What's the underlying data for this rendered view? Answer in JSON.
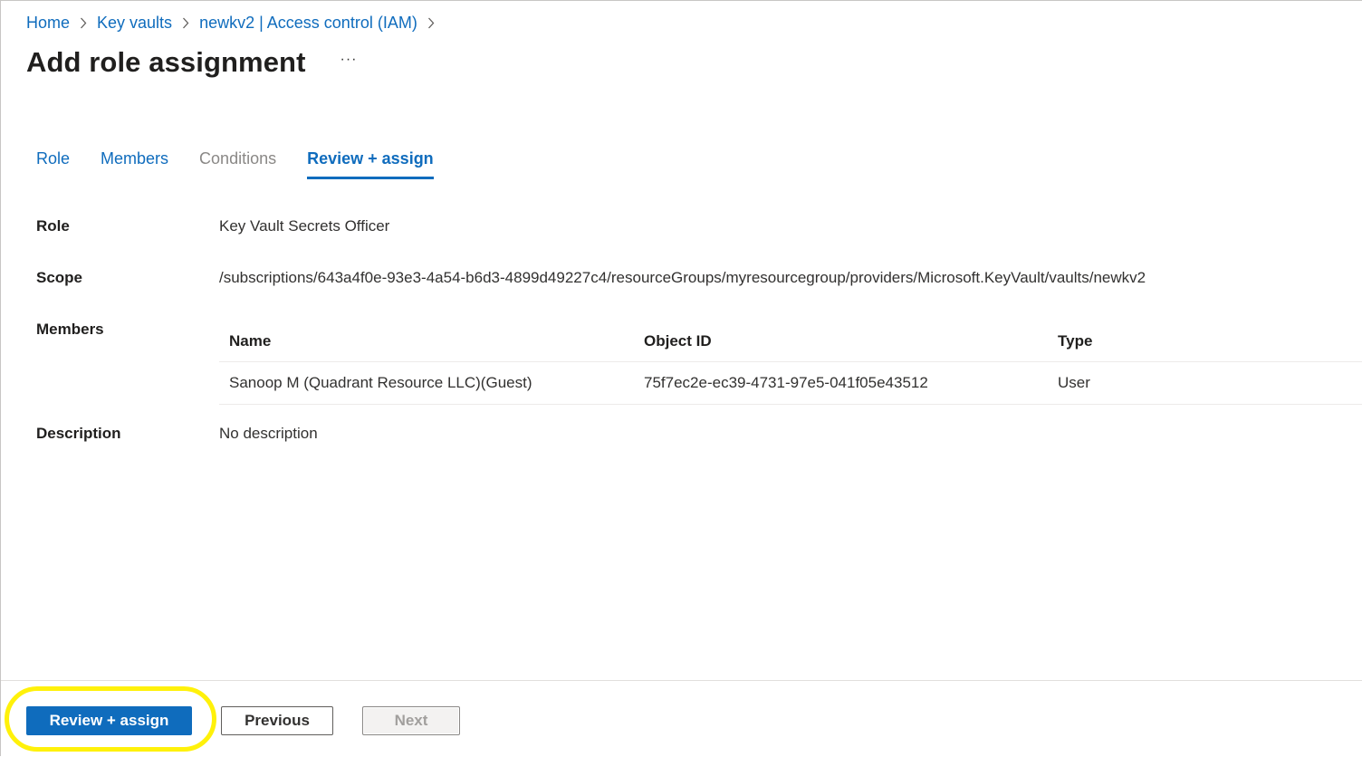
{
  "breadcrumb": {
    "items": [
      "Home",
      "Key vaults",
      "newkv2 | Access control (IAM)"
    ]
  },
  "page": {
    "title": "Add role assignment",
    "more_label": "···"
  },
  "tabs": [
    {
      "label": "Role",
      "state": "enabled"
    },
    {
      "label": "Members",
      "state": "enabled"
    },
    {
      "label": "Conditions",
      "state": "disabled"
    },
    {
      "label": "Review + assign",
      "state": "active"
    }
  ],
  "review": {
    "role_label": "Role",
    "role_value": "Key Vault Secrets Officer",
    "scope_label": "Scope",
    "scope_value": "/subscriptions/643a4f0e-93e3-4a54-b6d3-4899d49227c4/resourceGroups/myresourcegroup/providers/Microsoft.KeyVault/vaults/newkv2",
    "members_label": "Members",
    "description_label": "Description",
    "description_value": "No description"
  },
  "members_table": {
    "headers": [
      "Name",
      "Object ID",
      "Type"
    ],
    "rows": [
      {
        "name": "Sanoop M (Quadrant Resource LLC)(Guest)",
        "object_id": "75f7ec2e-ec39-4731-97e5-041f05e43512",
        "type": "User"
      }
    ]
  },
  "footer": {
    "review_assign_label": "Review + assign",
    "previous_label": "Previous",
    "next_label": "Next"
  },
  "colors": {
    "accent": "#0f6cbd",
    "highlight": "#fff10a"
  }
}
